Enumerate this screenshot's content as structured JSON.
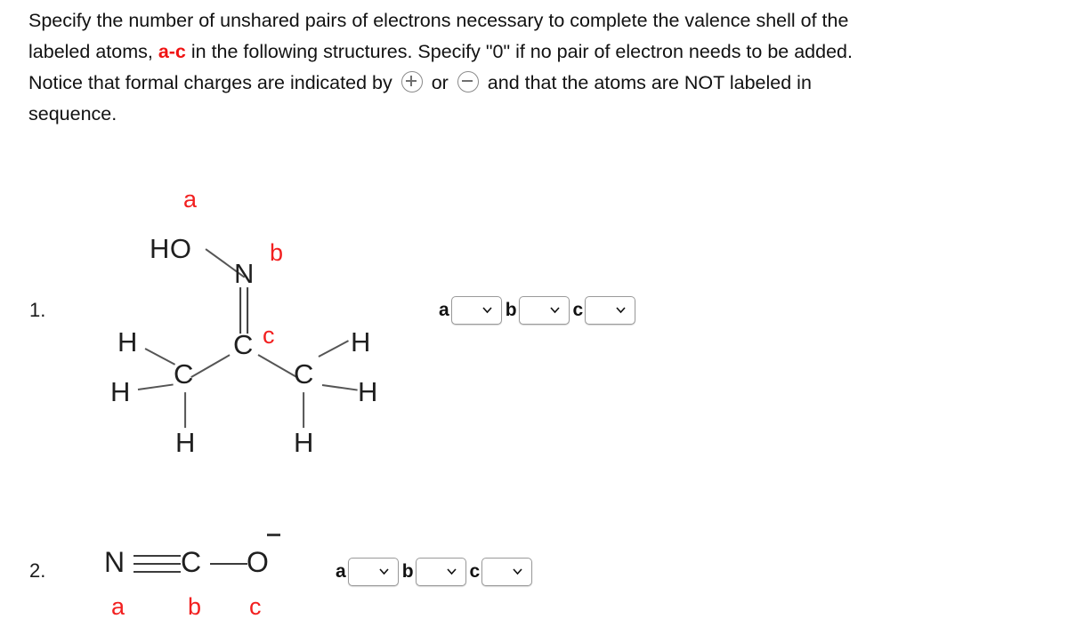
{
  "prompt": {
    "line1": "Specify the number of unshared pairs of electrons necessary to complete the valence shell of the",
    "line2_pre": "labeled atoms, ",
    "line2_red": "a-c",
    "line2_post": " in the following structures. Specify \"0\" if no pair of electron needs to be added.",
    "line3_pre": "Notice that formal charges are indicated by",
    "line3_or": "or",
    "line3_post": "and that the atoms are NOT labeled in",
    "line4": "sequence.",
    "plus_icon": "circled-plus-icon",
    "minus_icon": "circled-minus-icon"
  },
  "questions": [
    {
      "number": "1.",
      "structure": {
        "name": "acetone-oxime",
        "atoms": [
          {
            "text": "HO",
            "id": "ho-group"
          },
          {
            "text": "N",
            "id": "nitrogen"
          },
          {
            "text": "C",
            "id": "central-carbon"
          },
          {
            "text": "C",
            "id": "left-methyl-carbon"
          },
          {
            "text": "C",
            "id": "right-methyl-carbon"
          },
          {
            "text": "H",
            "id": "left-methyl-h-top"
          },
          {
            "text": "H",
            "id": "left-methyl-h-left"
          },
          {
            "text": "H",
            "id": "left-methyl-h-bottom"
          },
          {
            "text": "H",
            "id": "right-methyl-h-top"
          },
          {
            "text": "H",
            "id": "right-methyl-h-right"
          },
          {
            "text": "H",
            "id": "right-methyl-h-bottom"
          }
        ],
        "labels": [
          {
            "text": "a",
            "target": "oxygen"
          },
          {
            "text": "b",
            "target": "nitrogen"
          },
          {
            "text": "c",
            "target": "central-carbon"
          }
        ]
      },
      "answers": [
        {
          "letter": "a",
          "value": "",
          "placeholder": ""
        },
        {
          "letter": "b",
          "value": "",
          "placeholder": ""
        },
        {
          "letter": "c",
          "value": "",
          "placeholder": ""
        }
      ]
    },
    {
      "number": "2.",
      "structure": {
        "name": "cyanate-ion",
        "atoms": [
          {
            "text": "N",
            "id": "nitrogen"
          },
          {
            "text": "C",
            "id": "carbon"
          },
          {
            "text": "O",
            "id": "oxygen"
          }
        ],
        "charge": "−",
        "labels": [
          {
            "text": "a",
            "target": "nitrogen"
          },
          {
            "text": "b",
            "target": "carbon"
          },
          {
            "text": "c",
            "target": "oxygen"
          }
        ]
      },
      "answers": [
        {
          "letter": "a",
          "value": "",
          "placeholder": ""
        },
        {
          "letter": "b",
          "value": "",
          "placeholder": ""
        },
        {
          "letter": "c",
          "value": "",
          "placeholder": ""
        }
      ]
    }
  ],
  "colors": {
    "label_red": "#f22020",
    "text": "#121212",
    "bond": "#555555",
    "dropdown_border": "#9a9a9a"
  }
}
